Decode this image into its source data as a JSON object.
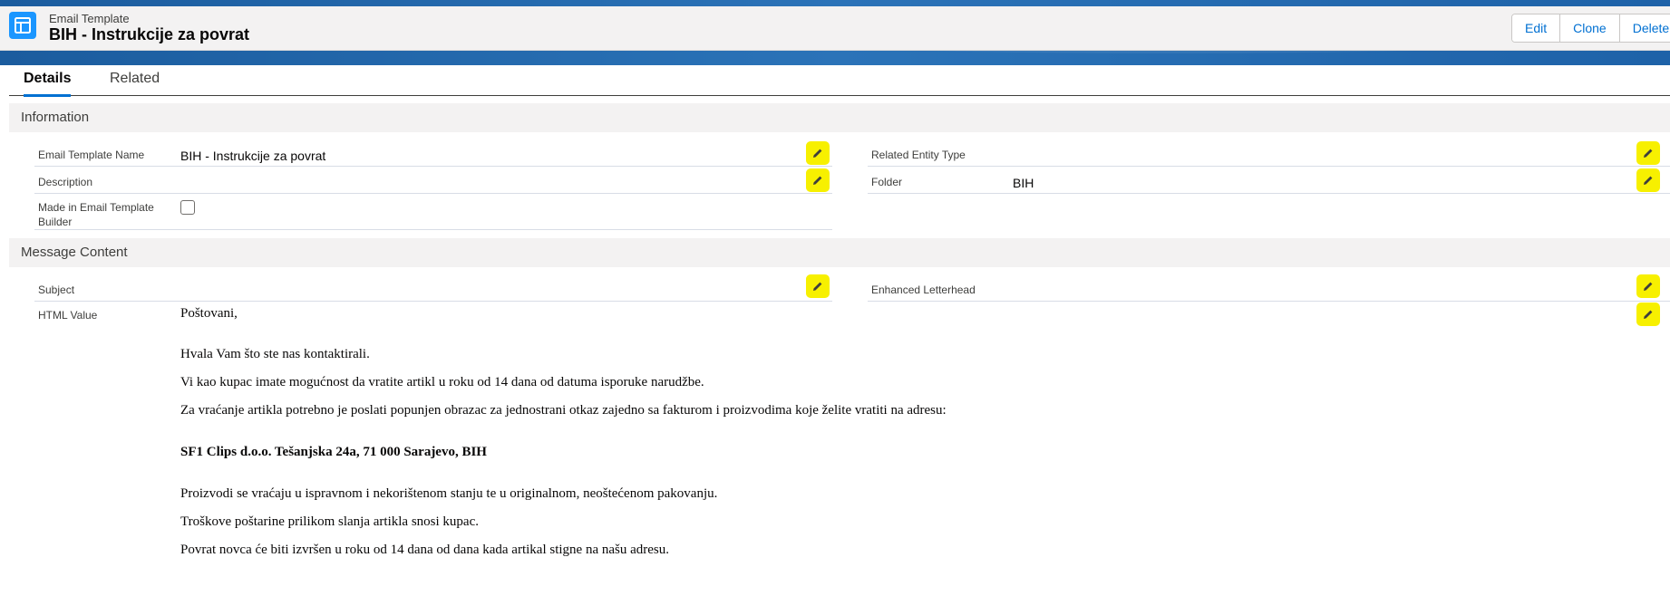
{
  "header": {
    "object_type": "Email Template",
    "record_name": "BIH - Instrukcije za povrat",
    "object_icon": "email-template-icon",
    "buttons": {
      "edit": "Edit",
      "clone": "Clone",
      "delete": "Delete"
    }
  },
  "tabs": {
    "details": "Details",
    "related": "Related"
  },
  "sections": {
    "information": "Information",
    "message_content": "Message Content"
  },
  "fields": {
    "template_name_label": "Email Template Name",
    "template_name_value": "BIH - Instrukcije za povrat",
    "description_label": "Description",
    "description_value": "",
    "made_in_builder_label_line1": "Made in Email Template",
    "made_in_builder_label_line2": "Builder",
    "made_in_builder_checked": false,
    "related_entity_label": "Related Entity Type",
    "related_entity_value": "",
    "folder_label": "Folder",
    "folder_value": "BIH",
    "subject_label": "Subject",
    "subject_value": "",
    "letterhead_label": "Enhanced Letterhead",
    "letterhead_value": "",
    "html_value_label": "HTML Value"
  },
  "html_value": {
    "greeting": "Poštovani,",
    "p1": "Hvala Vam što ste nas kontaktirali.",
    "p2": "Vi kao kupac imate mogućnost da vratite artikl u roku od 14 dana od datuma isporuke narudžbe.",
    "p3": "Za vraćanje artikla potrebno je poslati popunjen obrazac za jednostrani otkaz zajedno sa fakturom i proizvodima koje želite vratiti na adresu:",
    "address": "SF1 Clips d.o.o. Tešanjska 24a, 71 000 Sarajevo, BIH",
    "p4": "Proizvodi se vraćaju u ispravnom i nekorištenom stanju te u originalnom, neoštećenom pakovanju.",
    "p5": "Troškove poštarine prilikom slanja artikla snosi kupac.",
    "p6": "Povrat novca će biti izvršen u roku od 14 dana od dana kada artikal stigne na našu adresu."
  },
  "colors": {
    "brand": "#0070d2",
    "highlight": "#f7f000",
    "banner": "#2b73b8"
  }
}
